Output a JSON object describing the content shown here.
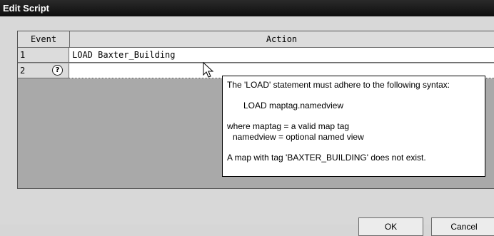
{
  "window": {
    "title": "Edit Script"
  },
  "table": {
    "columns": [
      "Event",
      "Action"
    ],
    "rows": [
      {
        "event": "1",
        "action": "LOAD Baxter_Building"
      },
      {
        "event": "2",
        "action": "",
        "icon": "help-icon"
      }
    ]
  },
  "tooltip": {
    "line1": "The 'LOAD' statement must adhere to the following syntax:",
    "line2": "LOAD maptag.namedview",
    "line3": "where maptag = a valid map tag",
    "line4": "namedview = optional named view",
    "line5": "A map with tag 'BAXTER_BUILDING' does not exist."
  },
  "buttons": {
    "ok": "OK",
    "cancel": "Cancel"
  }
}
